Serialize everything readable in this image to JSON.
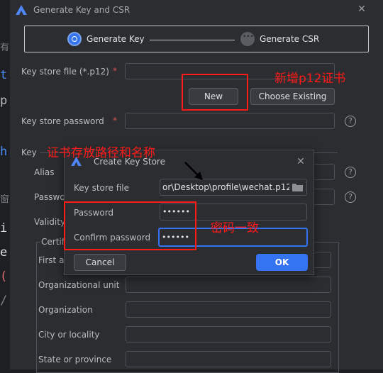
{
  "main_dialog": {
    "title": "Generate Key and CSR",
    "steps": [
      {
        "label": "Generate Key",
        "active": true
      },
      {
        "label": "Generate CSR",
        "active": false
      }
    ],
    "key_store_file_label": "Key store file (*.p12)",
    "key_store_file_value": "",
    "required_mark": "*",
    "new_button": "New",
    "choose_existing_button": "Choose Existing",
    "key_store_password_label": "Key store password",
    "key_section_label": "Key",
    "alias_label": "Alias",
    "password_label_partial": "Passwo",
    "validity_label_partial": "Validity",
    "certificate_label_partial": "Certif",
    "first_name_label_partial": "First an",
    "organizational_unit_label": "Organizational unit",
    "organization_label": "Organization",
    "city_label": "City or locality",
    "state_label": "State or province",
    "help_glyph": "?"
  },
  "create_key_store_dialog": {
    "title": "Create Key Store",
    "key_store_file_label": "Key store file",
    "key_store_file_value": "or\\Desktop\\profile\\wechat.p12",
    "password_label": "Password",
    "password_value": "••••••",
    "confirm_password_label": "Confirm password",
    "confirm_password_value": "••••••",
    "cancel_button": "Cancel",
    "ok_button": "OK"
  },
  "annotations": {
    "new_p12": "新增p12证书",
    "path_and_name": "证书存放路径和名称",
    "password_match": "密码一致"
  },
  "editor_strip_glyphs": [
    "有",
    "t",
    "p",
    "h",
    "窗",
    "i",
    "e",
    "(",
    "/"
  ],
  "colors": {
    "accent": "#3574f0",
    "annotation_red": "#ff1a1a",
    "background": "#2b2d30"
  }
}
